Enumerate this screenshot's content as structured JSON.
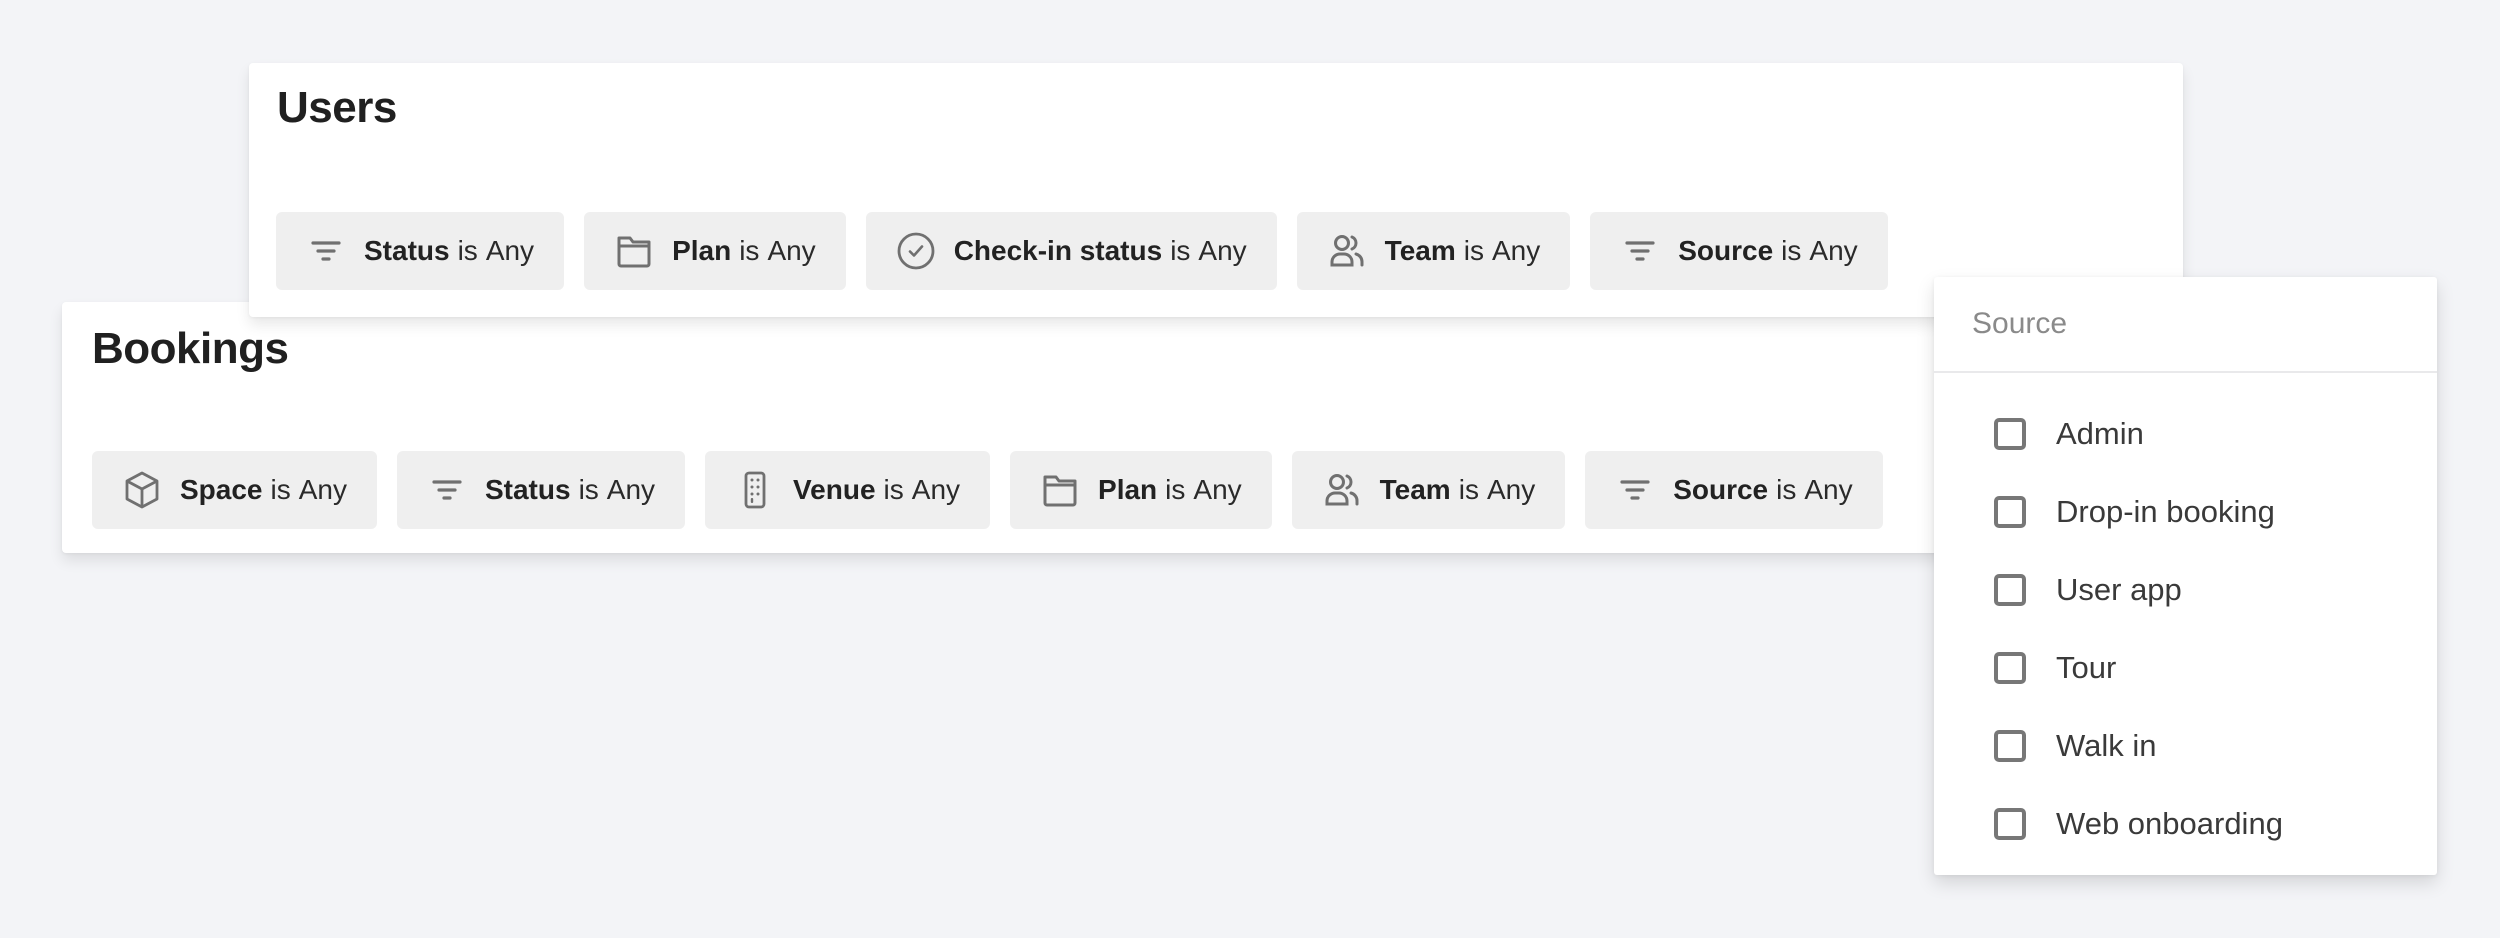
{
  "users": {
    "title": "Users",
    "filters": [
      {
        "icon": "filter-lines-icon",
        "field": "Status",
        "operator": "is",
        "value": "Any"
      },
      {
        "icon": "folder-icon",
        "field": "Plan",
        "operator": "is",
        "value": "Any"
      },
      {
        "icon": "check-circle-icon",
        "field": "Check-in status",
        "operator": "is",
        "value": "Any"
      },
      {
        "icon": "team-icon",
        "field": "Team",
        "operator": "is",
        "value": "Any"
      },
      {
        "icon": "filter-lines-icon",
        "field": "Source",
        "operator": "is",
        "value": "Any"
      }
    ]
  },
  "bookings": {
    "title": "Bookings",
    "filters": [
      {
        "icon": "cube-icon",
        "field": "Space",
        "operator": "is",
        "value": "Any"
      },
      {
        "icon": "filter-lines-icon",
        "field": "Status",
        "operator": "is",
        "value": "Any"
      },
      {
        "icon": "building-icon",
        "field": "Venue",
        "operator": "is",
        "value": "Any"
      },
      {
        "icon": "folder-icon",
        "field": "Plan",
        "operator": "is",
        "value": "Any"
      },
      {
        "icon": "team-icon",
        "field": "Team",
        "operator": "is",
        "value": "Any"
      },
      {
        "icon": "filter-lines-icon",
        "field": "Source",
        "operator": "is",
        "value": "Any"
      }
    ]
  },
  "source_dropdown": {
    "search_placeholder": "Source",
    "search_value": "",
    "options": [
      {
        "label": "Admin",
        "checked": false
      },
      {
        "label": "Drop-in booking",
        "checked": false
      },
      {
        "label": "User app",
        "checked": false
      },
      {
        "label": "Tour",
        "checked": false
      },
      {
        "label": "Walk in",
        "checked": false
      },
      {
        "label": "Web onboarding",
        "checked": false
      }
    ]
  },
  "colors": {
    "background": "#f3f4f7",
    "chip_background": "#efefef",
    "icon_gray": "#6f6f6f",
    "text_dark": "#202020"
  }
}
